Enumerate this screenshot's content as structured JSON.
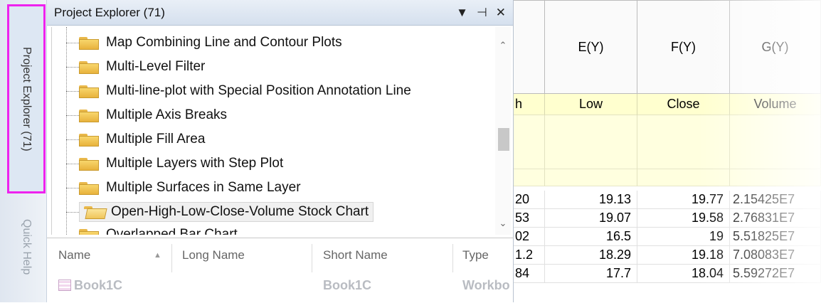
{
  "side_tabs": {
    "project_explorer": "Project Explorer (71)",
    "quick_help": "Quick Help"
  },
  "panel": {
    "title": "Project Explorer (71)",
    "dropdown_glyph": "▼",
    "pin_glyph": "⊣",
    "close_glyph": "✕"
  },
  "tree": {
    "items": [
      {
        "label": "Map Combining Line and Contour Plots"
      },
      {
        "label": "Multi-Level Filter"
      },
      {
        "label": "Multi-line-plot with Special Position Annotation Line"
      },
      {
        "label": "Multiple Axis Breaks"
      },
      {
        "label": "Multiple Fill Area"
      },
      {
        "label": "Multiple Layers with Step Plot"
      },
      {
        "label": "Multiple Surfaces in Same Layer"
      },
      {
        "label": "Open-High-Low-Close-Volume Stock Chart"
      },
      {
        "label": "Overlapped Bar Chart"
      }
    ],
    "selected_index": 7,
    "scroll_up": "⌃",
    "scroll_down": "⌄"
  },
  "listview": {
    "columns": [
      "Name",
      "Long Name",
      "Short Name",
      "Type"
    ],
    "sort_glyph": "▲",
    "rows": [
      {
        "name": "Book1C",
        "long_name": "",
        "short_name": "Book1C",
        "type": "Workbo"
      }
    ]
  },
  "sheet": {
    "columns": [
      {
        "header": "",
        "long_name": "h",
        "cells": [
          "20",
          "53",
          "02",
          "1.2",
          "84"
        ]
      },
      {
        "header": "E(Y)",
        "long_name": "Low",
        "cells": [
          "19.13",
          "19.07",
          "16.5",
          "18.29",
          "17.7"
        ]
      },
      {
        "header": "F(Y)",
        "long_name": "Close",
        "cells": [
          "19.77",
          "19.58",
          "19",
          "19.18",
          "18.04"
        ]
      },
      {
        "header": "G(Y)",
        "long_name": "Volume",
        "cells": [
          "2.15425E7",
          "2.76831E7",
          "5.51825E7",
          "7.08083E7",
          "5.59272E7"
        ]
      }
    ]
  },
  "colors": {
    "highlight_border": "#ee22ee",
    "long_name_row": "#ffffcf"
  }
}
